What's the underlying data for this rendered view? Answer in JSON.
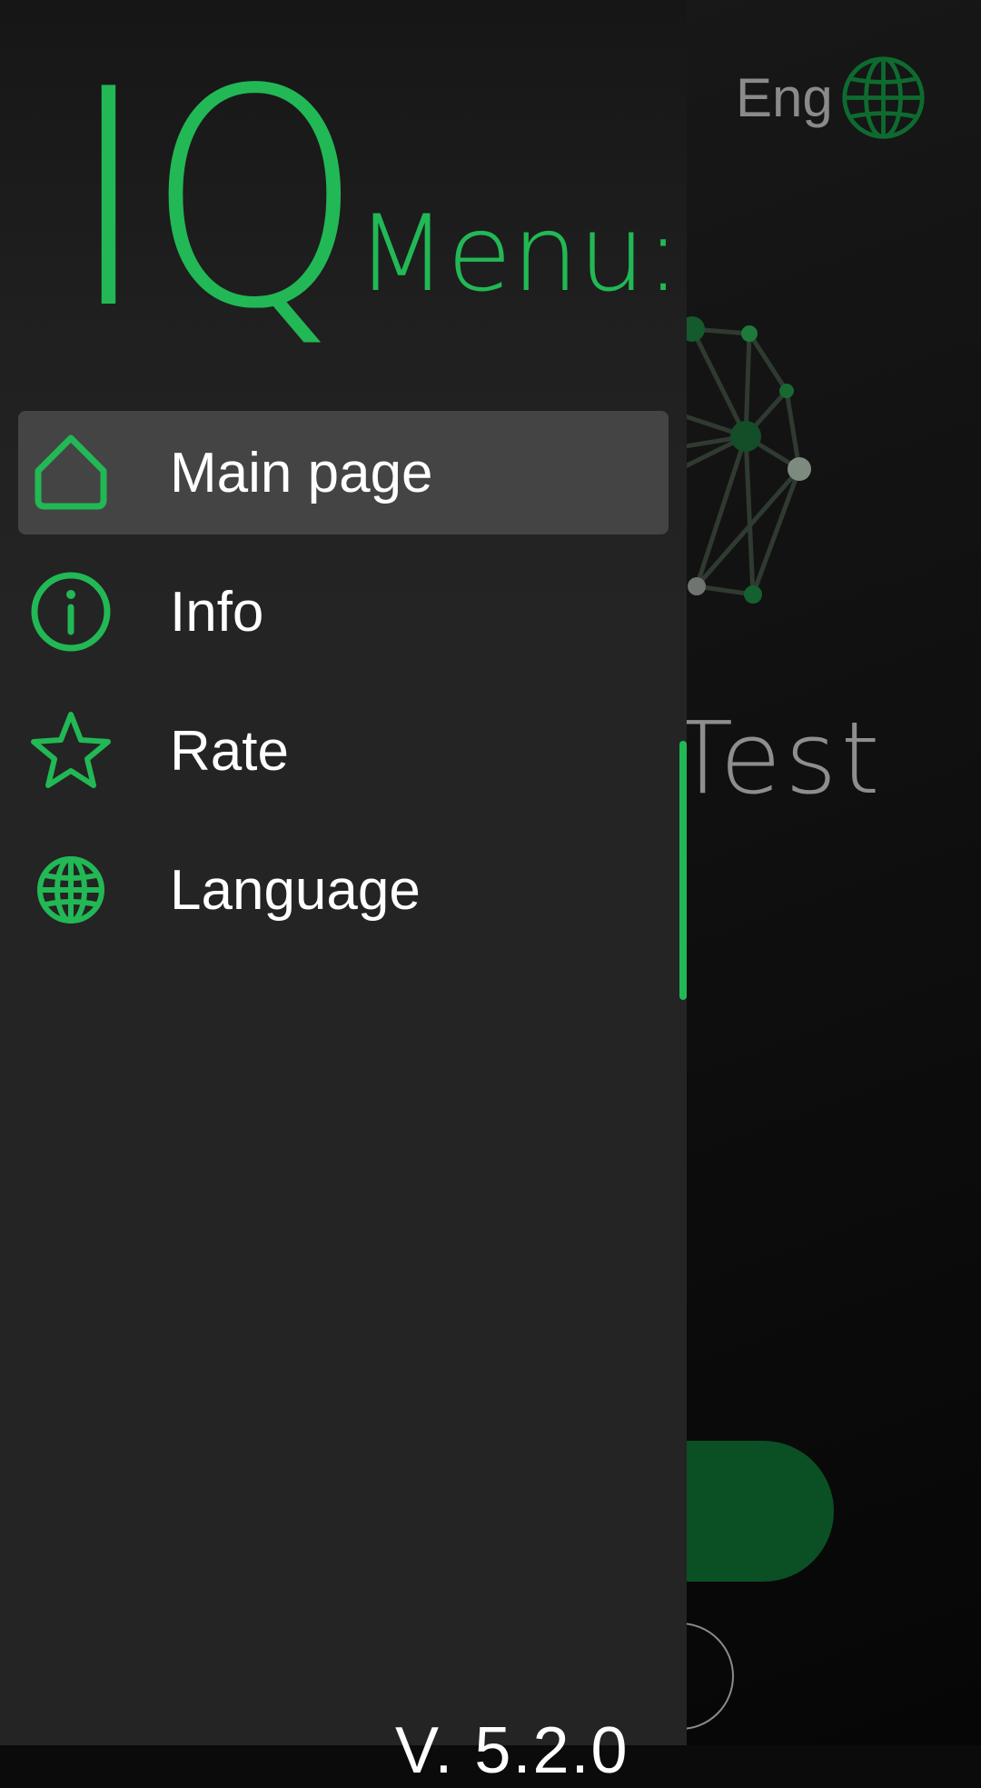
{
  "background": {
    "language_label": "Eng",
    "title_fragment": "Test",
    "accent_dark": "#0b4f24"
  },
  "drawer": {
    "logo": "IQ",
    "heading": "Menu:",
    "accent": "#22b855",
    "items": [
      {
        "label": "Main page",
        "icon": "home-icon",
        "active": true
      },
      {
        "label": "Info",
        "icon": "info-icon",
        "active": false
      },
      {
        "label": "Rate",
        "icon": "star-icon",
        "active": false
      },
      {
        "label": "Language",
        "icon": "globe-icon",
        "active": false
      }
    ],
    "version": "V. 5.2.0"
  }
}
